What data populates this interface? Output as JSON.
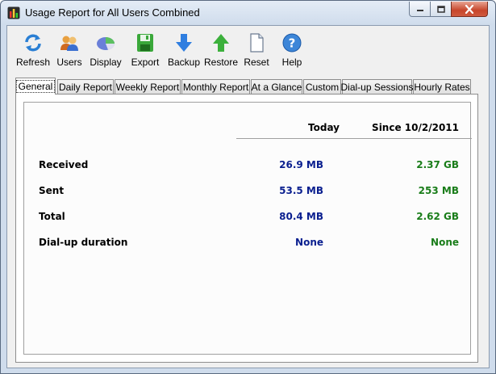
{
  "window": {
    "title": "Usage Report for All Users Combined"
  },
  "toolbar": {
    "items": [
      {
        "label": "Refresh",
        "icon": "refresh-icon"
      },
      {
        "label": "Users",
        "icon": "users-icon"
      },
      {
        "label": "Display",
        "icon": "display-icon"
      },
      {
        "label": "Export",
        "icon": "export-save-icon"
      },
      {
        "label": "Backup",
        "icon": "backup-down-arrow-icon"
      },
      {
        "label": "Restore",
        "icon": "restore-up-arrow-icon"
      },
      {
        "label": "Reset",
        "icon": "reset-page-icon"
      },
      {
        "label": "Help",
        "icon": "help-icon"
      }
    ]
  },
  "tabs": [
    {
      "label": "General",
      "active": true
    },
    {
      "label": "Daily Report"
    },
    {
      "label": "Weekly Report"
    },
    {
      "label": "Monthly Report"
    },
    {
      "label": "At a Glance"
    },
    {
      "label": "Custom"
    },
    {
      "label": "Dial-up Sessions"
    },
    {
      "label": "Hourly Rates"
    }
  ],
  "report": {
    "columns": {
      "today": "Today",
      "since": "Since 10/2/2011"
    },
    "rows": [
      {
        "label": "Received",
        "today": "26.9 MB",
        "since": "2.37 GB"
      },
      {
        "label": "Sent",
        "today": "53.5 MB",
        "since": "253 MB"
      },
      {
        "label": "Total",
        "today": "80.4 MB",
        "since": "2.62 GB"
      },
      {
        "label": "Dial-up duration",
        "today": "None",
        "since": "None"
      }
    ]
  },
  "colors": {
    "today_value": "#0a1f8f",
    "since_value": "#1a7d1a"
  }
}
